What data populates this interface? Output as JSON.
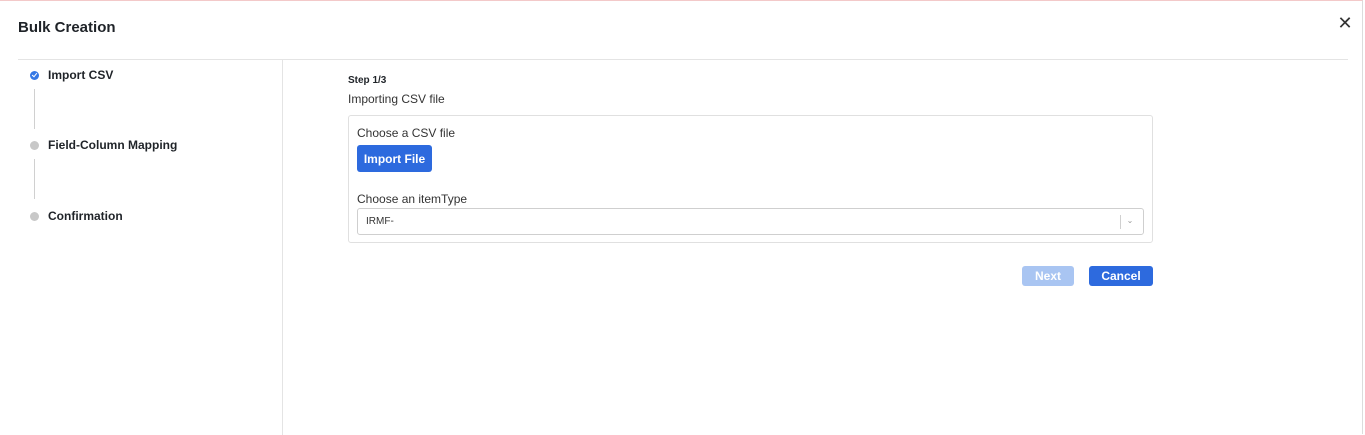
{
  "dialog": {
    "title": "Bulk Creation",
    "close_icon": "close-icon"
  },
  "steps": [
    {
      "label": "Import CSV",
      "status": "active"
    },
    {
      "label": "Field-Column Mapping",
      "status": "pending"
    },
    {
      "label": "Confirmation",
      "status": "pending"
    }
  ],
  "main": {
    "step_counter": "Step 1/3",
    "step_title": "Importing CSV file",
    "csv_label": "Choose a CSV file",
    "import_button": "Import File",
    "item_type_label": "Choose an itemType",
    "item_type_value": "IRMF-"
  },
  "footer": {
    "next_label": "Next",
    "next_disabled": true,
    "cancel_label": "Cancel"
  },
  "colors": {
    "primary": "#2d6ade",
    "primary_disabled": "#a9c5f2",
    "step_active": "#3578e5",
    "step_pending": "#c8c8c8"
  }
}
